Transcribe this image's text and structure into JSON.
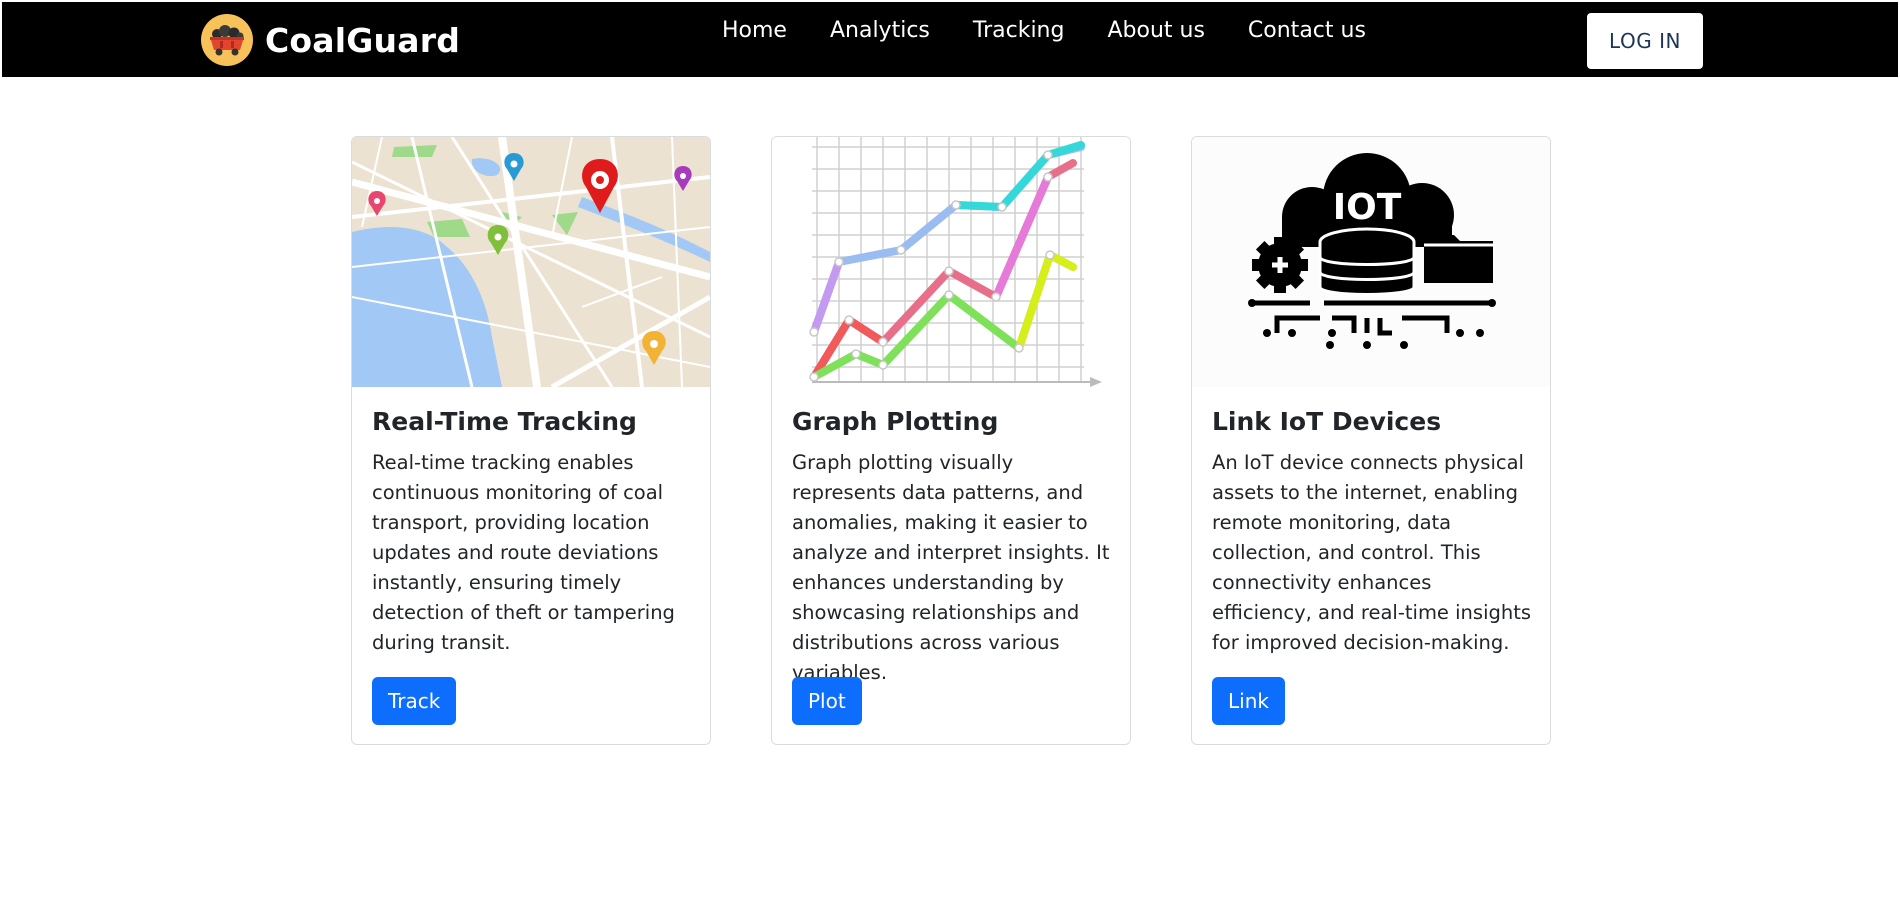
{
  "brand": {
    "name": "CoalGuard",
    "logo_icon": "coal-cart-icon"
  },
  "nav": {
    "links": [
      "Home",
      "Analytics",
      "Tracking",
      "About us",
      "Contact us"
    ],
    "login_label": "LOG IN"
  },
  "colors": {
    "navbar": "#000000",
    "primary_button": "#0d6efd",
    "logo_badge": "#f8c25a"
  },
  "cards": [
    {
      "image_icon": "map-with-pins-icon",
      "title": "Real-Time Tracking",
      "text": "Real-time tracking enables continuous monitoring of coal transport, providing location updates and route deviations instantly, ensuring timely detection of theft or tampering during transit.",
      "button": "Track"
    },
    {
      "image_icon": "line-graph-icon",
      "title": "Graph Plotting",
      "text": "Graph plotting visually represents data patterns, and anomalies, making it easier to analyze and interpret insights. It enhances understanding by showcasing relationships and distributions across various variables.",
      "button": "Plot"
    },
    {
      "image_icon": "iot-cloud-icon",
      "image_label": "IOT",
      "title": "Link IoT Devices",
      "text": "An IoT device connects physical assets to the internet, enabling remote monitoring, data collection, and control. This connectivity enhances efficiency, and real-time insights for improved decision-making.",
      "button": "Link"
    }
  ]
}
